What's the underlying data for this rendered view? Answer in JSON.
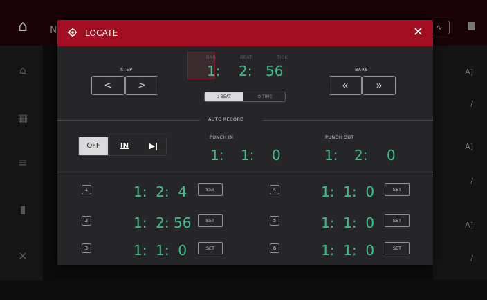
{
  "background": {
    "topbar_letter": "N",
    "right_col": [
      "A]",
      "/",
      "A]",
      "/",
      "A]",
      "/"
    ]
  },
  "dialog": {
    "title": "LOCATE",
    "close_symbol": "✕"
  },
  "step": {
    "label": "STEP",
    "prev": "<",
    "next": ">"
  },
  "position": {
    "bar_label": "BAR",
    "beat_label": "BEAT",
    "tick_label": "TICK",
    "bar": "1:",
    "beat": "2:",
    "tick": "56"
  },
  "bars": {
    "label": "BARS",
    "prev": "«",
    "next": "»"
  },
  "mode_toggle": {
    "beat": "BEAT",
    "time": "TIME",
    "selected": "beat"
  },
  "auto_record": {
    "label": "AUTO RECORD",
    "off": "OFF",
    "in": "IN",
    "out": "▶|",
    "punch_in_label": "PUNCH IN",
    "punch_in": [
      "1:",
      "1:",
      "0"
    ],
    "punch_out_label": "PUNCH OUT",
    "punch_out": [
      "1:",
      "2:",
      "0"
    ]
  },
  "locates": [
    {
      "num": "1",
      "value": "1:  2:  4",
      "set": "SET"
    },
    {
      "num": "2",
      "value": "1:  2: 56",
      "set": "SET"
    },
    {
      "num": "3",
      "value": "1:  1:  0",
      "set": "SET"
    },
    {
      "num": "4",
      "value": "1:  1:  0",
      "set": "SET"
    },
    {
      "num": "5",
      "value": "1:  1:  0",
      "set": "SET"
    },
    {
      "num": "6",
      "value": "1:  1:  0",
      "set": "SET"
    }
  ],
  "colors": {
    "header": "#a30e23",
    "value_green": "#3fbf93",
    "panel": "#262628"
  }
}
